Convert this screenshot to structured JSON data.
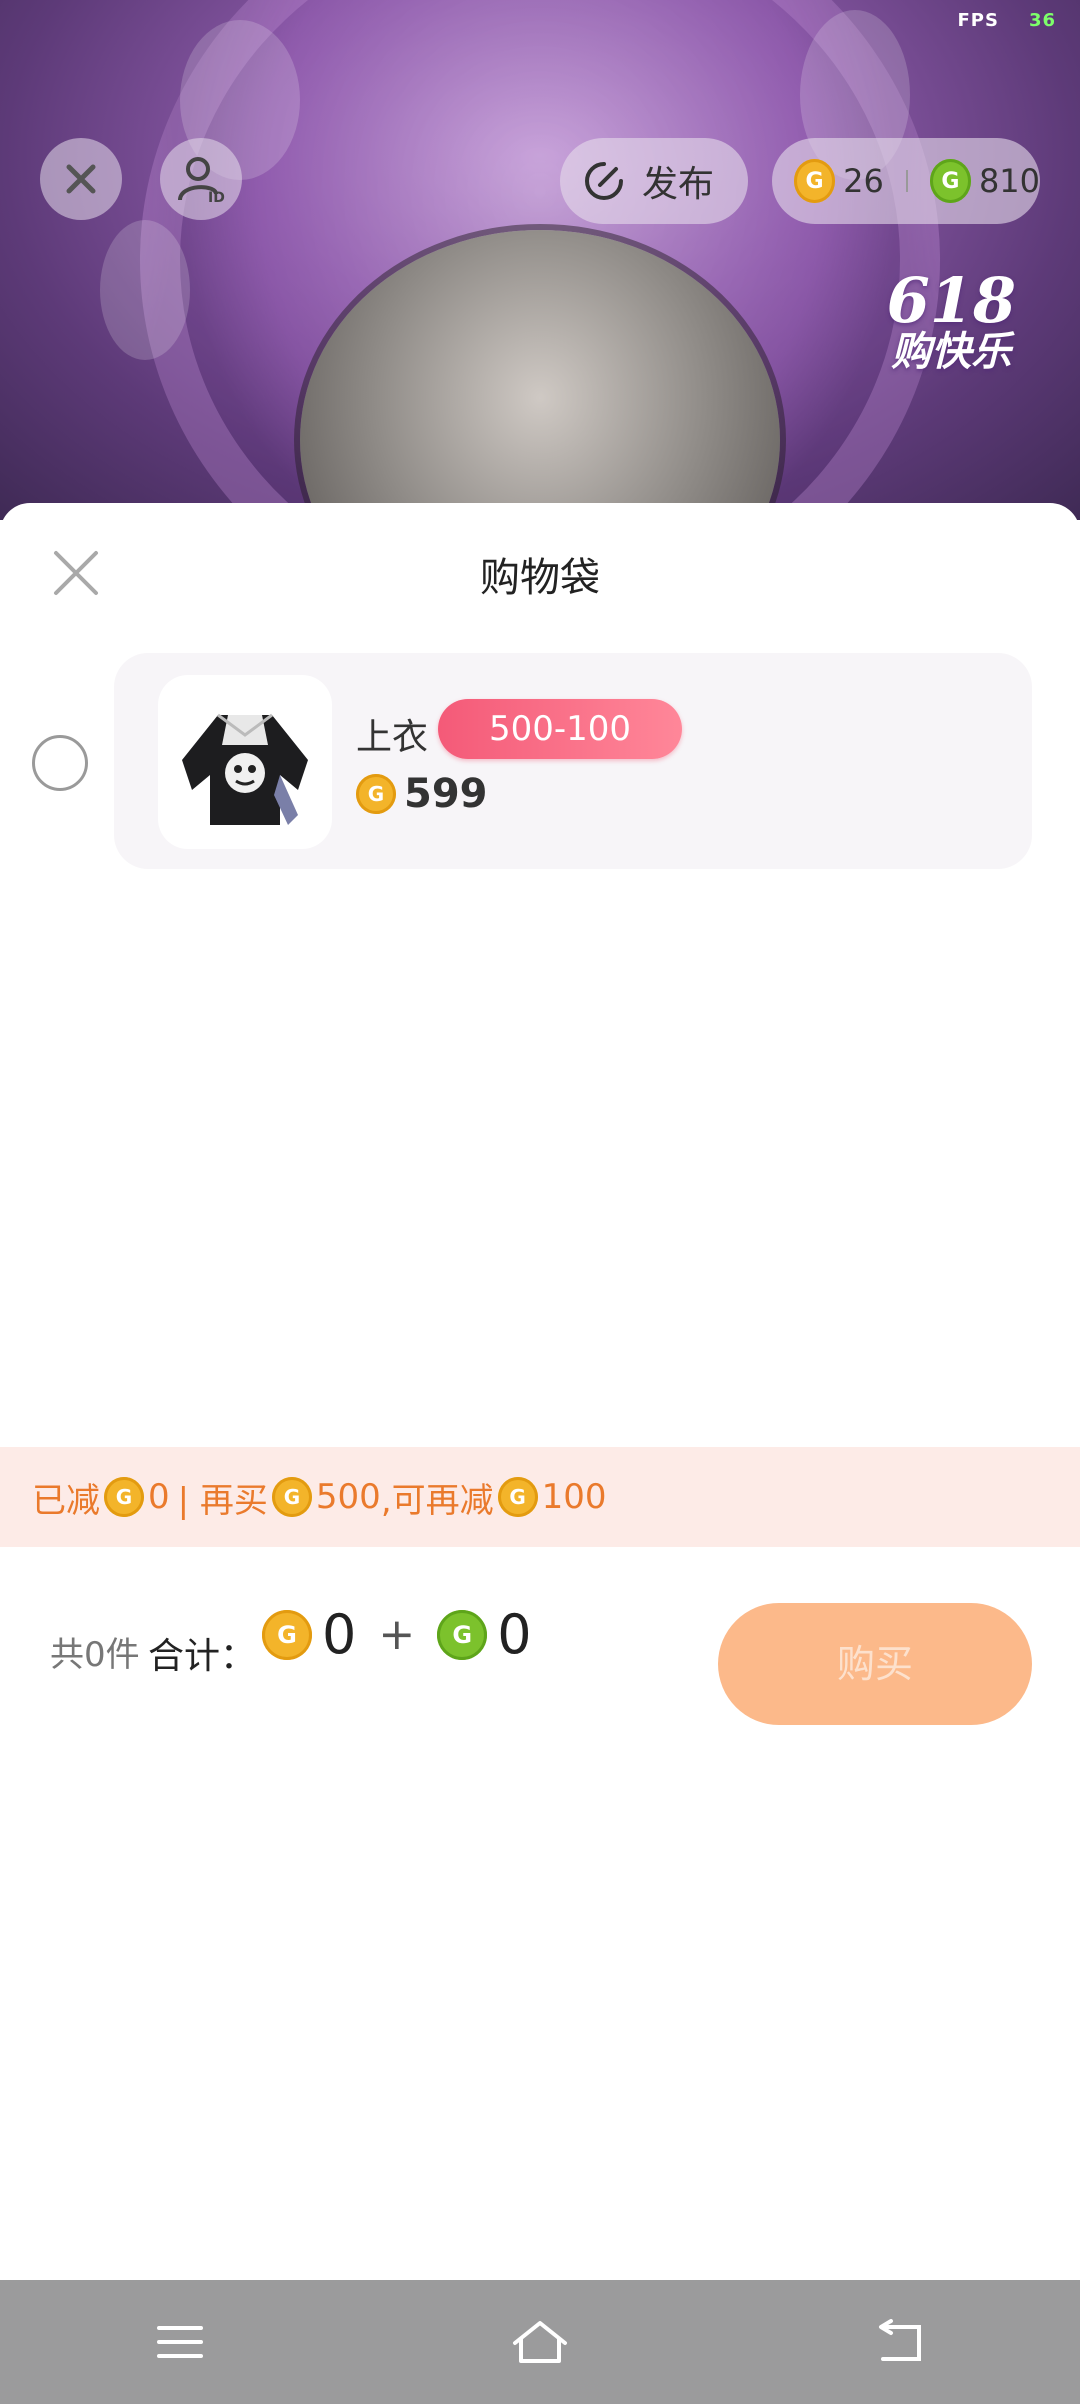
{
  "status": {
    "fps_label": "FPS",
    "fps_value": "36"
  },
  "topbar": {
    "publish_label": "发布",
    "gold_balance": "26",
    "green_balance": "810",
    "promo_number": "618",
    "promo_text": "购快乐"
  },
  "sheet": {
    "title": "购物袋",
    "items": [
      {
        "name": "上衣",
        "discount_tag": "500-100",
        "price": "599",
        "selected": false
      }
    ]
  },
  "promo_bar": {
    "prefix": "已减",
    "reduced": "0",
    "mid": "| 再买",
    "more_needed": "500",
    "mid2": ",可再减",
    "more_reduce": "100"
  },
  "footer": {
    "count_text": "共0件",
    "total_label": "合计：",
    "gold_total": "0",
    "plus": "+",
    "green_total": "0",
    "buy_label": "购买"
  },
  "colors": {
    "accent_orange": "#fcb98a",
    "promo_text": "#ea7a2c",
    "discount_tag": "#f45a78",
    "gold_coin": "#f3b42a",
    "green_coin": "#7cc22c"
  },
  "icons": [
    "close-icon",
    "user-id-icon",
    "publish-icon",
    "gold-coin-icon",
    "green-coin-icon",
    "menu-icon",
    "home-icon",
    "back-icon"
  ]
}
